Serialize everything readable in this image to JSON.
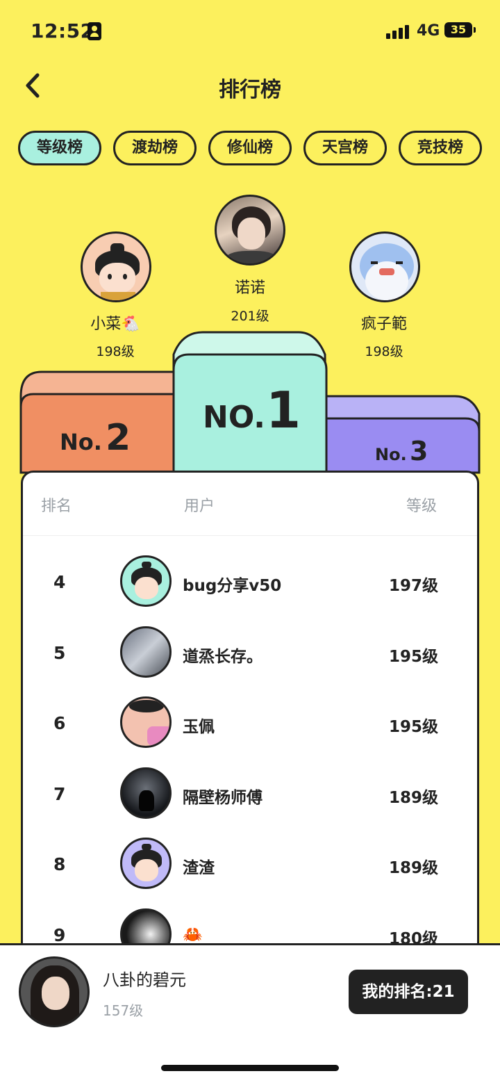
{
  "status": {
    "time": "12:52",
    "network": "4G",
    "battery": "35"
  },
  "header": {
    "title": "排行榜"
  },
  "tabs": [
    "等级榜",
    "渡劫榜",
    "修仙榜",
    "天宫榜",
    "竞技榜"
  ],
  "podium": [
    {
      "rank_label": "No.1",
      "name": "诺诺",
      "level": "201级"
    },
    {
      "rank_label": "No.2",
      "name": "小菜🐔",
      "level": "198级"
    },
    {
      "rank_label": "No.3",
      "name": "疯子範",
      "level": "198级"
    }
  ],
  "table": {
    "headers": {
      "rank": "排名",
      "user": "用户",
      "level": "等级"
    },
    "rows": [
      {
        "rank": "4",
        "name": "bug分享v50",
        "level": "197级"
      },
      {
        "rank": "5",
        "name": "道烝长存。",
        "level": "195级"
      },
      {
        "rank": "6",
        "name": "玉佩",
        "level": "195级"
      },
      {
        "rank": "7",
        "name": "隔壁杨师傅",
        "level": "189级"
      },
      {
        "rank": "8",
        "name": "渣渣",
        "level": "189级"
      },
      {
        "rank": "9",
        "name": "🦀",
        "level": "180级"
      }
    ]
  },
  "me": {
    "name": "八卦的碧元",
    "level": "157级",
    "rank_button": "我的排名:21"
  },
  "colors": {
    "background": "#fcf05d",
    "active_tab": "#a9f0df",
    "no1": "#a9f0df",
    "no2": "#f08f63",
    "no3": "#9a8cf2"
  }
}
